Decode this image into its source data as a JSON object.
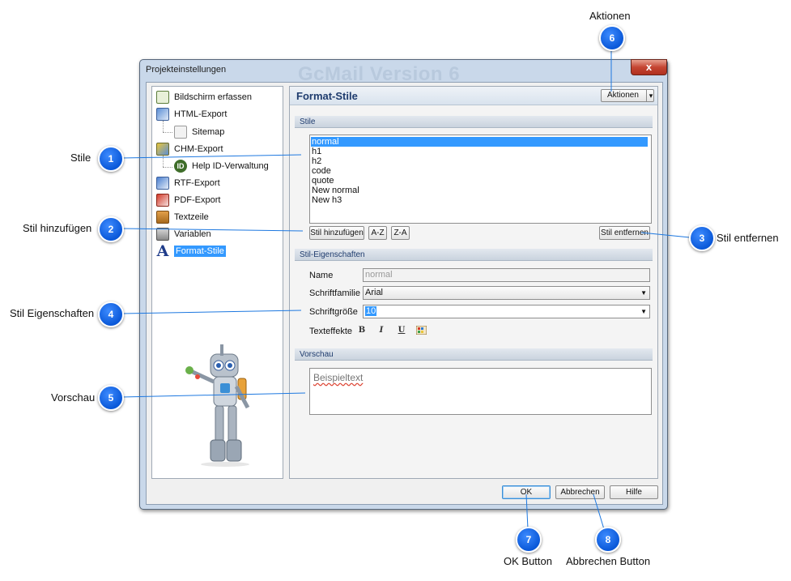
{
  "dialog": {
    "title": "Projekteinstellungen",
    "ghost_text": "GcMail Version 6",
    "close_label": "x"
  },
  "tree": {
    "items": [
      {
        "label": "Bildschirm erfassen",
        "icon": "capture-icon"
      },
      {
        "label": "HTML-Export",
        "icon": "html-export-icon"
      },
      {
        "label": "Sitemap",
        "icon": "sitemap-icon"
      },
      {
        "label": "CHM-Export",
        "icon": "chm-export-icon"
      },
      {
        "label": "Help ID-Verwaltung",
        "icon": "help-id-icon"
      },
      {
        "label": "RTF-Export",
        "icon": "rtf-export-icon"
      },
      {
        "label": "PDF-Export",
        "icon": "pdf-export-icon"
      },
      {
        "label": "Textzeile",
        "icon": "textzeile-icon"
      },
      {
        "label": "Variablen",
        "icon": "variablen-icon"
      },
      {
        "label": "Format-Stile",
        "icon": "format-stile-icon",
        "selected": true
      }
    ],
    "help_id_icon_text": "ID",
    "format_icon_text": "A"
  },
  "panel": {
    "title": "Format-Stile",
    "actions_label": "Aktionen",
    "actions_arrow": "▾",
    "sections": {
      "stile": "Stile",
      "eigenschaften": "Stil-Eigenschaften",
      "vorschau": "Vorschau"
    },
    "styles": [
      "normal",
      "h1",
      "h2",
      "code",
      "quote",
      "New normal",
      "New h3"
    ],
    "selected_style": "normal",
    "buttons": {
      "add": "Stil hinzufügen",
      "az": "A-Z",
      "za": "Z-A",
      "remove": "Stil entfernen"
    },
    "properties": {
      "name_label": "Name",
      "name_value": "normal",
      "font_family_label": "Schriftfamilie",
      "font_family_value": "Arial",
      "font_size_label": "Schriftgröße",
      "font_size_value": "10",
      "effects_label": "Texteffekte",
      "effects": [
        "B",
        "I",
        "U"
      ],
      "dropdown_arrow": "▼"
    },
    "preview_text": "Beispieltext"
  },
  "footer": {
    "ok": "OK",
    "cancel": "Abbrechen",
    "help": "Hilfe"
  },
  "annotations": [
    {
      "num": "1",
      "label": "Stile"
    },
    {
      "num": "2",
      "label": "Stil hinzufügen"
    },
    {
      "num": "3",
      "label": "Stil entfernen"
    },
    {
      "num": "4",
      "label": "Stil Eigenschaften"
    },
    {
      "num": "5",
      "label": "Vorschau"
    },
    {
      "num": "6",
      "label": "Aktionen"
    },
    {
      "num": "7",
      "label": "OK Button"
    },
    {
      "num": "8",
      "label": "Abbrechen Button"
    }
  ],
  "colors": {
    "callout": "#0a58d8",
    "selection": "#3399ff",
    "section_text": "#1f3c6e"
  }
}
